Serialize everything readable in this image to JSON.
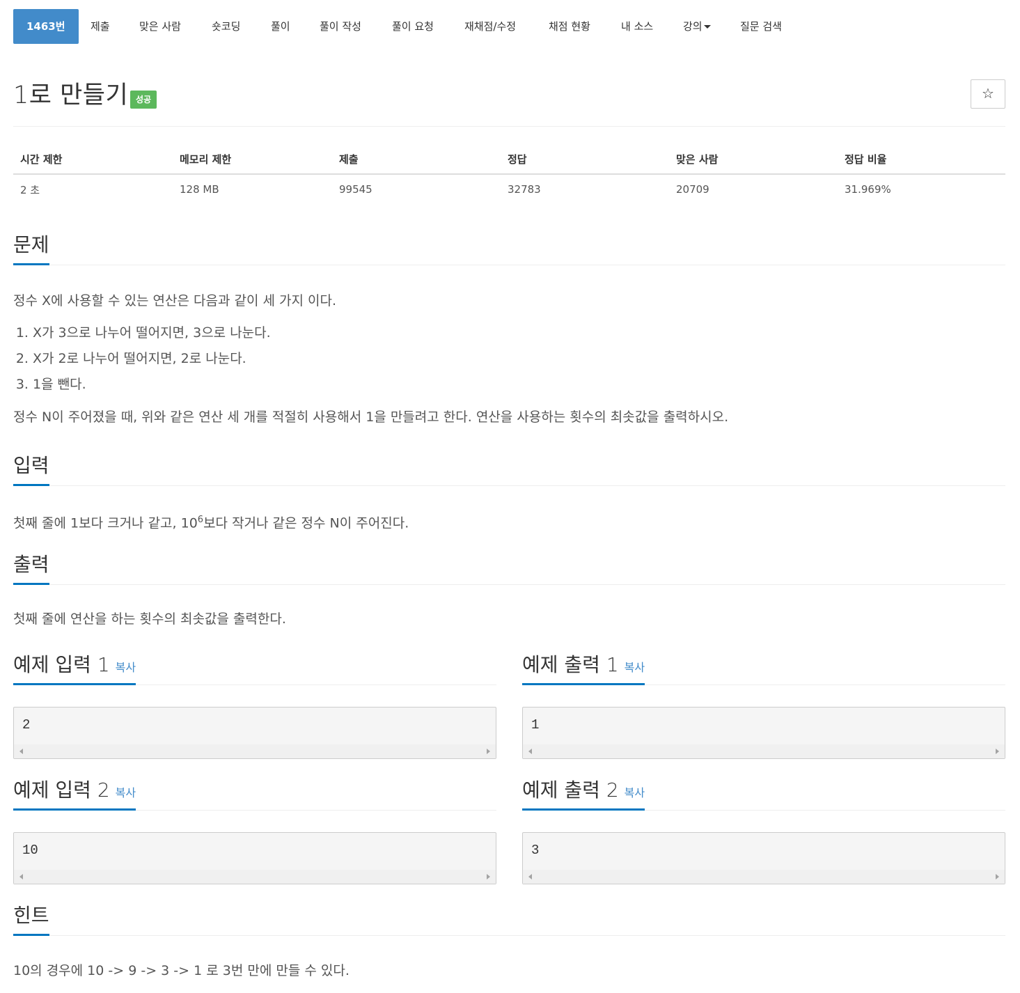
{
  "nav": {
    "tabs": [
      "1463번",
      "제출",
      "맞은 사람",
      "숏코딩",
      "풀이",
      "풀이 작성",
      "풀이 요청",
      "재채점/수정",
      "채점 현황",
      "내 소스",
      "강의",
      "질문 검색"
    ]
  },
  "problem": {
    "title": "1로 만들기",
    "badge": "성공",
    "star": "☆"
  },
  "info": {
    "headers": [
      "시간 제한",
      "메모리 제한",
      "제출",
      "정답",
      "맞은 사람",
      "정답 비율"
    ],
    "values": [
      "2 초",
      "128 MB",
      "99545",
      "32783",
      "20709",
      "31.969%"
    ]
  },
  "description": {
    "heading": "문제",
    "intro": "정수 X에 사용할 수 있는 연산은 다음과 같이 세 가지 이다.",
    "steps": [
      "X가 3으로 나누어 떨어지면, 3으로 나눈다.",
      "X가 2로 나누어 떨어지면, 2로 나눈다.",
      "1을 뺀다."
    ],
    "outro": "정수 N이 주어졌을 때, 위와 같은 연산 세 개를 적절히 사용해서 1을 만들려고 한다. 연산을 사용하는 횟수의 최솟값을 출력하시오."
  },
  "input": {
    "heading": "입력",
    "text_before": "첫째 줄에 1보다 크거나 같고, 10",
    "sup": "6",
    "text_after": "보다 작거나 같은 정수 N이 주어진다."
  },
  "output": {
    "heading": "출력",
    "text": "첫째 줄에 연산을 하는 횟수의 최솟값을 출력한다."
  },
  "samples": {
    "copy_label": "복사",
    "input1_heading": "예제 입력 1",
    "output1_heading": "예제 출력 1",
    "input2_heading": "예제 입력 2",
    "output2_heading": "예제 출력 2",
    "input1": "2",
    "output1": "1",
    "input2": "10",
    "output2": "3"
  },
  "hint": {
    "heading": "힌트",
    "text": "10의 경우에 10 -> 9 -> 3 -> 1 로 3번 만에 만들 수 있다."
  },
  "colors": {
    "active_tab": "#428bca",
    "badge_success": "#5cb85c",
    "heading_underline": "#0076c0",
    "copy_link": "#428bca"
  }
}
